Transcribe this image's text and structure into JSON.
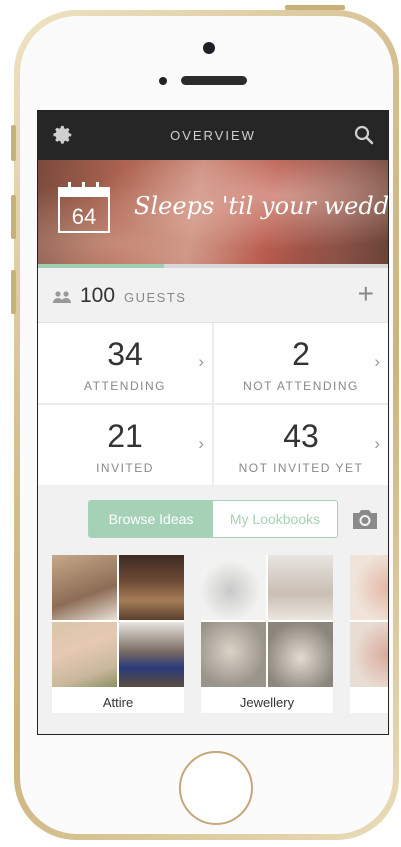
{
  "app": {
    "nav_title": "OVERVIEW",
    "icons": {
      "left": "gear-icon",
      "right": "search-icon"
    }
  },
  "banner": {
    "days": "64",
    "text": "Sleeps 'til your wedding",
    "progress_fraction": 0.36
  },
  "guests": {
    "count": "100",
    "label": "GUESTS",
    "add_label": "+"
  },
  "stats": [
    {
      "value": "34",
      "label": "ATTENDING"
    },
    {
      "value": "2",
      "label": "NOT ATTENDING"
    },
    {
      "value": "21",
      "label": "INVITED"
    },
    {
      "value": "43",
      "label": "NOT INVITED YET"
    }
  ],
  "tabs": {
    "browse": "Browse Ideas",
    "lookbooks": "My Lookbooks",
    "active": "browse"
  },
  "lookbooks": [
    {
      "name": "Attire"
    },
    {
      "name": "Jewellery"
    },
    {
      "name": ""
    }
  ],
  "colors": {
    "accent": "#a5d2b6",
    "nav_bg": "#262626",
    "phone_gold": "#d6c091"
  }
}
